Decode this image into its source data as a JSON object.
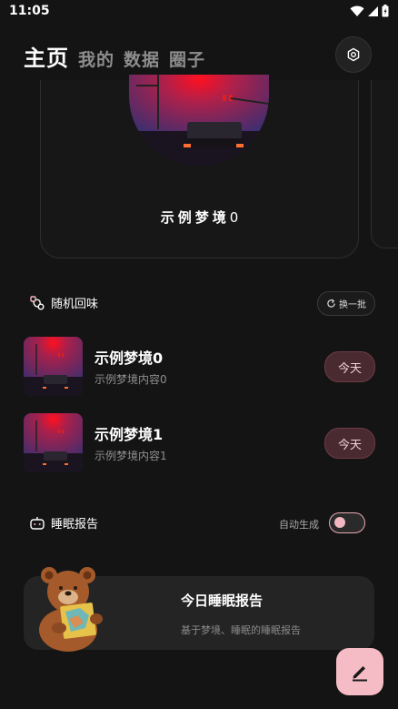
{
  "status": {
    "time": "11:05"
  },
  "nav": {
    "tabs": [
      {
        "label": "主页"
      },
      {
        "label": "我的"
      },
      {
        "label": "数据"
      },
      {
        "label": "圈子"
      }
    ]
  },
  "featured": {
    "title": "示例梦境",
    "number": "0"
  },
  "random": {
    "label": "随机回味",
    "swap_label": "换一批"
  },
  "dreams": [
    {
      "title": "示例梦境0",
      "subtitle": "示例梦境内容0",
      "date_label": "今天"
    },
    {
      "title": "示例梦境1",
      "subtitle": "示例梦境内容1",
      "date_label": "今天"
    }
  ],
  "sleep": {
    "label": "睡眠报告",
    "auto_label": "自动生成",
    "auto_enabled": false
  },
  "report": {
    "title": "今日睡眠报告",
    "subtitle": "基于梦境、睡眠的睡眠报告"
  },
  "icons": {
    "settings": "settings-icon",
    "edit": "edit-pen-icon",
    "shuffle": "shuffle-icon",
    "robot": "robot-icon",
    "refresh": "refresh-icon"
  },
  "colors": {
    "accent": "#f6bcc6",
    "badge_bg": "#4a2a31",
    "background": "#141414"
  }
}
